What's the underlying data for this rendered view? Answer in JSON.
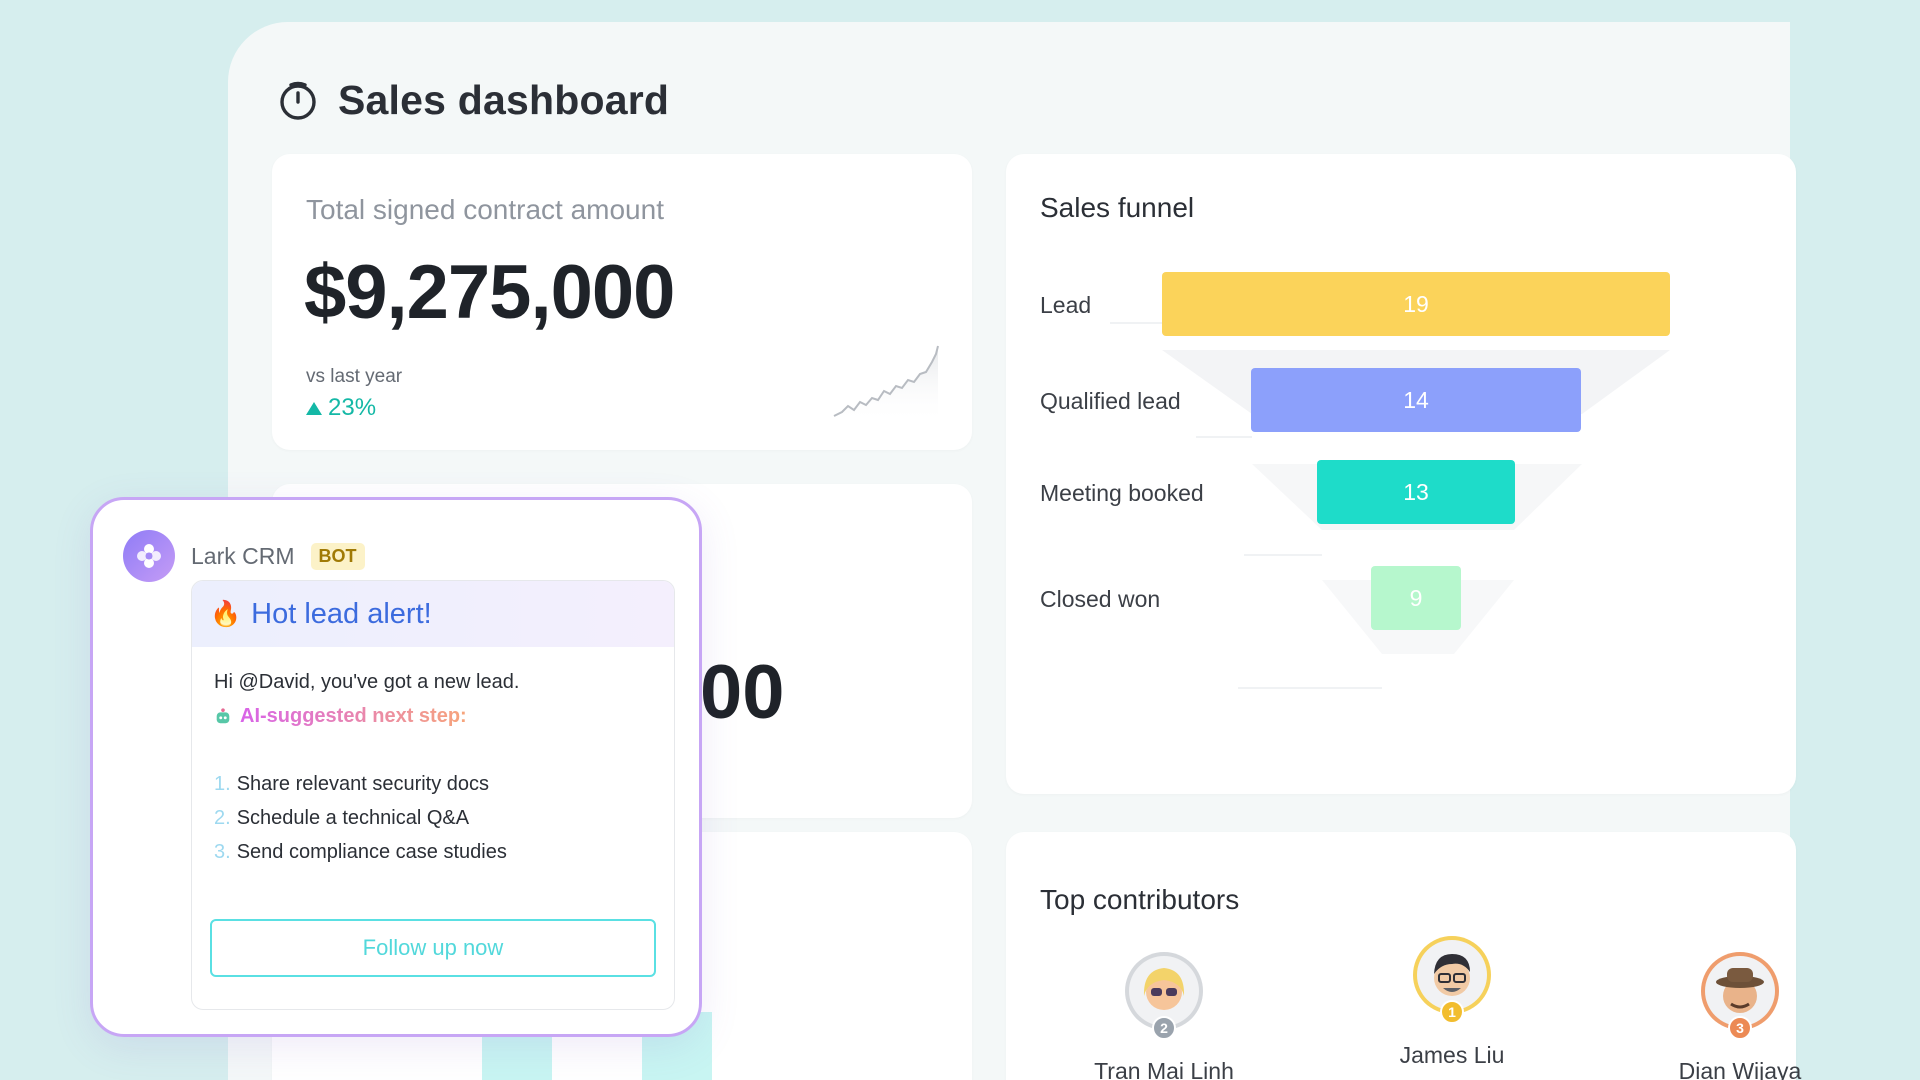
{
  "dashboard": {
    "title": "Sales dashboard",
    "icon": "timer-icon"
  },
  "contract": {
    "label": "Total signed contract amount",
    "amount": "$9,275,000",
    "vs_label": "vs last year",
    "vs_value": "23%",
    "trend": "up"
  },
  "second_card": {
    "partial_value": "00"
  },
  "funnel": {
    "title": "Sales funnel",
    "stages": [
      {
        "label": "Lead",
        "value": "19",
        "color": "#fbd35a"
      },
      {
        "label": "Qualified lead",
        "value": "14",
        "color": "#8ca0fb"
      },
      {
        "label": "Meeting booked",
        "value": "13",
        "color": "#1edcc9"
      },
      {
        "label": "Closed won",
        "value": "9",
        "color": "#b6f7cd"
      }
    ]
  },
  "chart_data": {
    "type": "bar",
    "title": "Sales funnel",
    "categories": [
      "Lead",
      "Qualified lead",
      "Meeting booked",
      "Closed won"
    ],
    "values": [
      19,
      14,
      13,
      9
    ]
  },
  "contributors": {
    "title": "Top contributors",
    "people": [
      {
        "name": "Tran Mai Linh",
        "rank": "2",
        "rank_color": "#9aa3ad"
      },
      {
        "name": "James Liu",
        "rank": "1",
        "rank_color": "#f2bd2f"
      },
      {
        "name": "Dian Wijaya",
        "rank": "3",
        "rank_color": "#ec8a55"
      }
    ]
  },
  "bot": {
    "name": "Lark CRM",
    "tag": "BOT",
    "alert_icon": "fire-icon",
    "alert_title": "Hot lead alert!",
    "greeting": "Hi @David, you've got a new lead.",
    "ai_label": "AI-suggested next step:",
    "steps": [
      {
        "num": "1.",
        "text": "Share relevant security docs"
      },
      {
        "num": "2.",
        "text": "Schedule a technical Q&A"
      },
      {
        "num": "3.",
        "text": "Send compliance case studies"
      }
    ],
    "button_label": "Follow up now"
  }
}
